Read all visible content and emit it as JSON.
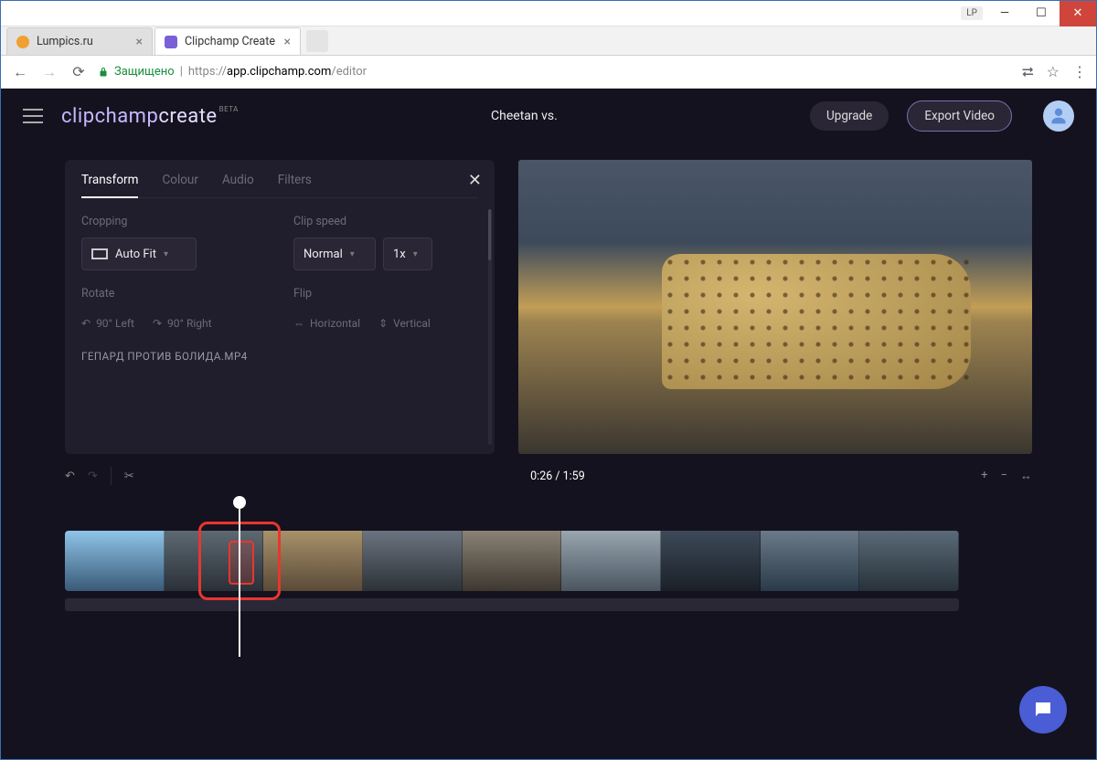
{
  "browser": {
    "badge": "LP",
    "tabs": [
      {
        "title": "Lumpics.ru",
        "favicon": "#f0a030"
      },
      {
        "title": "Clipchamp Create",
        "favicon": "#7a5fd8"
      }
    ],
    "secure_label": "Защищено",
    "url_prefix": "https://",
    "url_host": "app.clipchamp.com",
    "url_path": "/editor"
  },
  "header": {
    "logo_part1": "clipchamp",
    "logo_part2": "create",
    "logo_badge": "BETA",
    "project_title": "Cheetan vs.",
    "upgrade_label": "Upgrade",
    "export_label": "Export Video"
  },
  "panel": {
    "tabs": [
      "Transform",
      "Colour",
      "Audio",
      "Filters"
    ],
    "active_tab": 0,
    "cropping_label": "Cropping",
    "cropping_value": "Auto Fit",
    "clipspeed_label": "Clip speed",
    "clipspeed_value": "Normal",
    "clipspeed_mult": "1x",
    "rotate_label": "Rotate",
    "rotate_left": "90° Left",
    "rotate_right": "90° Right",
    "flip_label": "Flip",
    "flip_h": "Horizontal",
    "flip_v": "Vertical",
    "filename": "ГЕПАРД ПРОТИВ БОЛИДА.MP4"
  },
  "timeline": {
    "current": "0:26",
    "total": "1:59"
  }
}
